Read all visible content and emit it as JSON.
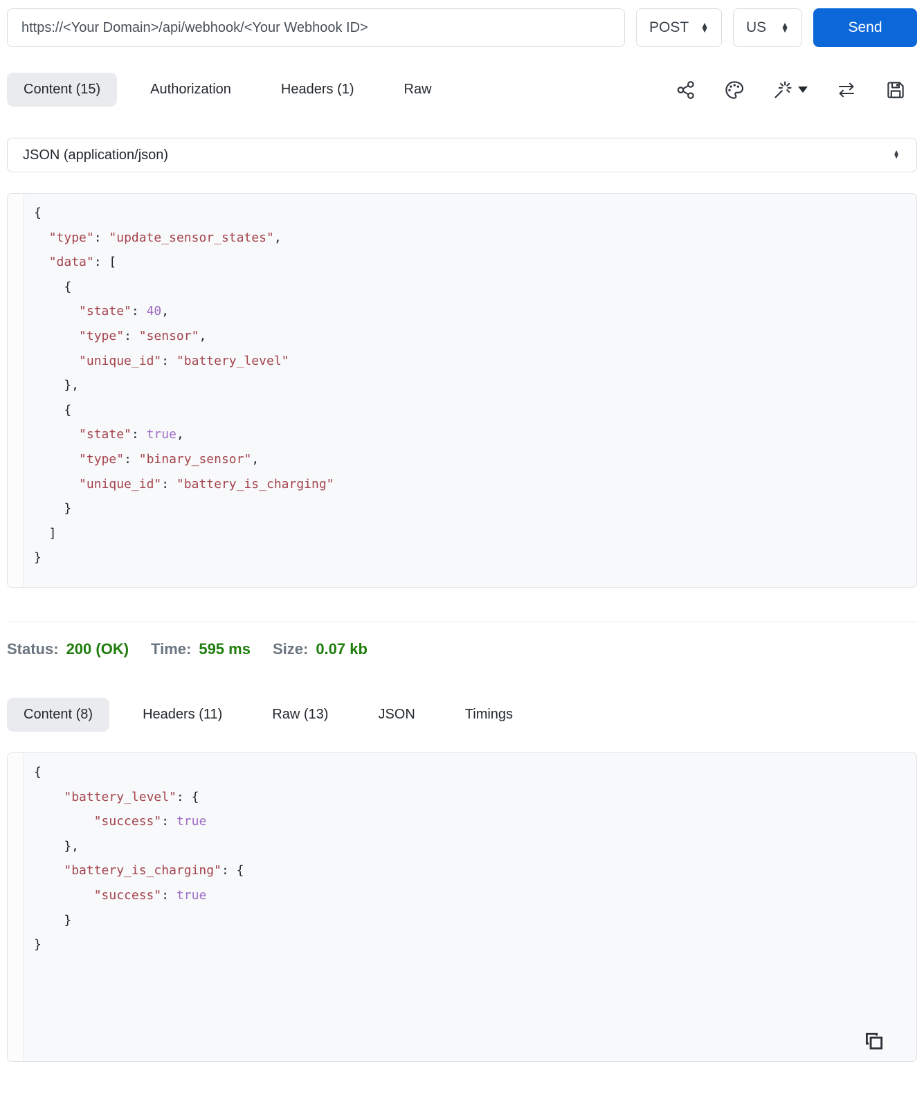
{
  "request_bar": {
    "url": "https://<Your Domain>/api/webhook/<Your Webhook ID>",
    "method": "POST",
    "region": "US",
    "send_label": "Send"
  },
  "request_tabs": {
    "content": "Content (15)",
    "authorization": "Authorization",
    "headers": "Headers (1)",
    "raw": "Raw"
  },
  "content_type": {
    "value": "JSON (application/json)"
  },
  "request_body": "{\n  \"type\": \"update_sensor_states\",\n  \"data\": [\n    {\n      \"state\": 40,\n      \"type\": \"sensor\",\n      \"unique_id\": \"battery_level\"\n    },\n    {\n      \"state\": true,\n      \"type\": \"binary_sensor\",\n      \"unique_id\": \"battery_is_charging\"\n    }\n  ]\n}",
  "status_bar": {
    "status_label": "Status:",
    "status_value": "200 (OK)",
    "time_label": "Time:",
    "time_value": "595 ms",
    "size_label": "Size:",
    "size_value": "0.07 kb"
  },
  "response_tabs": {
    "content": "Content (8)",
    "headers": "Headers (11)",
    "raw": "Raw (13)",
    "json": "JSON",
    "timings": "Timings"
  },
  "response_body": "{\n    \"battery_level\": {\n        \"success\": true\n    },\n    \"battery_is_charging\": {\n        \"success\": true\n    }\n}",
  "colors": {
    "accent": "#0c68d8",
    "green": "#1f7d0c",
    "gray-label": "#6b7580",
    "code-red": "#a4434d",
    "code-purple": "#9e6bc8"
  }
}
